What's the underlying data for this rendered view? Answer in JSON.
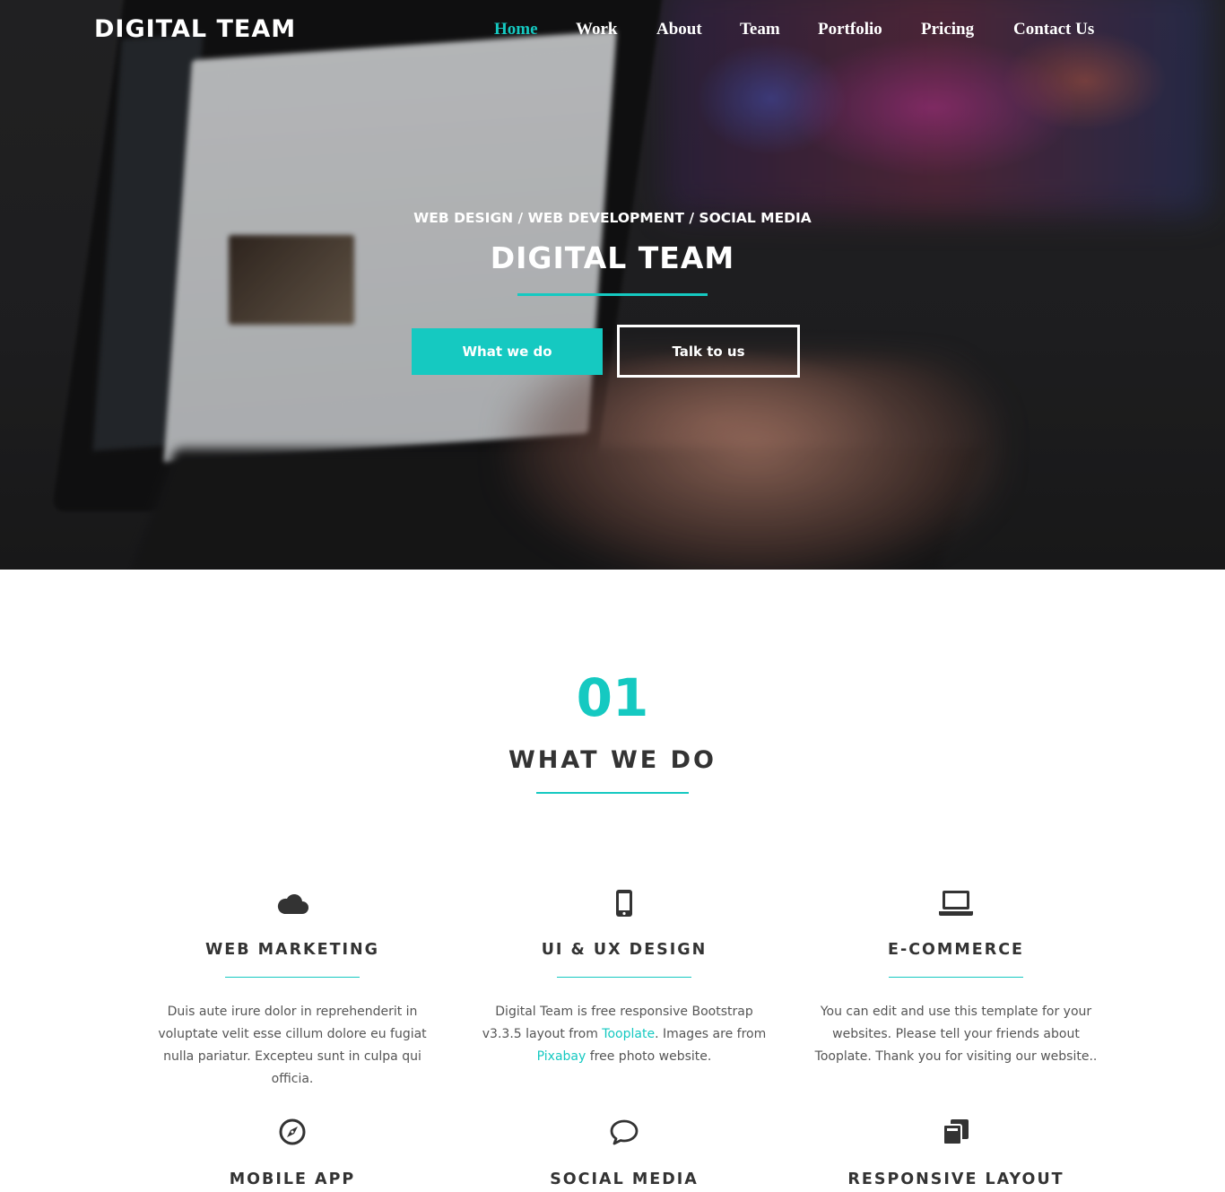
{
  "nav": {
    "brand": "DIGITAL TEAM",
    "items": [
      "Home",
      "Work",
      "About",
      "Team",
      "Portfolio",
      "Pricing",
      "Contact Us"
    ],
    "active": "Home"
  },
  "hero": {
    "subtitle": "WEB DESIGN / WEB DEVELOPMENT / SOCIAL MEDIA",
    "title": "DIGITAL TEAM",
    "primary_button": "What we do",
    "secondary_button": "Talk to us"
  },
  "section": {
    "number": "01",
    "title": "WHAT WE DO"
  },
  "services": [
    {
      "icon": "cloud-icon",
      "title": "WEB MARKETING",
      "text": "Duis aute irure dolor in reprehenderit in voluptate velit esse cillum dolore eu fugiat nulla pariatur. Excepteu sunt in culpa qui officia."
    },
    {
      "icon": "mobile-phone-icon",
      "title": "UI & UX DESIGN",
      "text_parts": [
        "Digital Team is free responsive Bootstrap v3.3.5 layout from ",
        "Tooplate",
        ". Images are from ",
        "Pixabay",
        " free photo website."
      ]
    },
    {
      "icon": "laptop-icon",
      "title": "E-COMMERCE",
      "text": "You can edit and use this template for your websites. Please tell your friends about Tooplate. Thank you for visiting our website.."
    },
    {
      "icon": "compass-icon",
      "title": "MOBILE APP"
    },
    {
      "icon": "chat-bubble-icon",
      "title": "SOCIAL MEDIA"
    },
    {
      "icon": "layers-copy-icon",
      "title": "RESPONSIVE LAYOUT"
    }
  ],
  "colors": {
    "accent": "#15c9c1",
    "heading": "#333333",
    "body_text": "#555555"
  }
}
